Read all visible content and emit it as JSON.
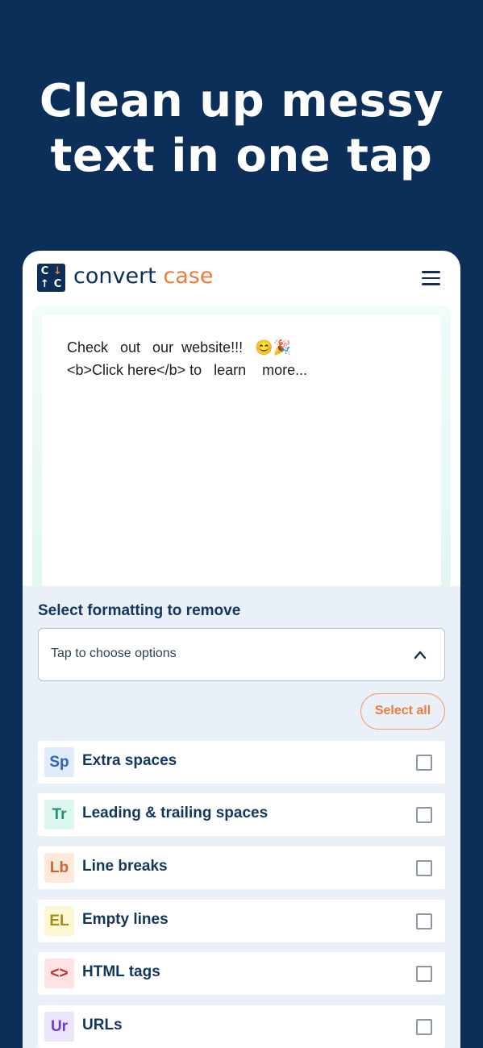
{
  "headline": {
    "line1": "Clean up messy",
    "line2": "text in one tap"
  },
  "app": {
    "brand_part1": "convert",
    "brand_part2": "case",
    "logo_glyphs": [
      "C",
      "↓",
      "↑",
      "C"
    ],
    "menu_icon": "hamburger-menu-icon"
  },
  "editor": {
    "text": "Check   out   our  website!!!   😊🎉\n<b>Click here</b> to   learn    more..."
  },
  "panel": {
    "title": "Select formatting to remove",
    "dropdown_label": "Tap to choose options",
    "dropdown_icon": "chevron-up-icon",
    "select_all_label": "Select all"
  },
  "options": [
    {
      "badge": "Sp",
      "label": "Extra spaces",
      "checked": false,
      "badge_bg": "#e1ecfb",
      "badge_fg": "#2f63b8"
    },
    {
      "badge": "Tr",
      "label": "Leading & trailing spaces",
      "checked": false,
      "badge_bg": "#dcf6ef",
      "badge_fg": "#1f8f72"
    },
    {
      "badge": "Lb",
      "label": "Line breaks",
      "checked": false,
      "badge_bg": "#fde8dc",
      "badge_fg": "#d0632a"
    },
    {
      "badge": "EL",
      "label": "Empty lines",
      "checked": false,
      "badge_bg": "#fdf7d4",
      "badge_fg": "#a88912"
    },
    {
      "badge": "<>",
      "label": "HTML tags",
      "checked": false,
      "badge_bg": "#fde3e3",
      "badge_fg": "#c72b2b"
    },
    {
      "badge": "Ur",
      "label": "URLs",
      "checked": false,
      "badge_bg": "#ece5fa",
      "badge_fg": "#6e3fc4"
    }
  ],
  "colors": {
    "background": "#0c2f5a",
    "accent": "#f07a3a",
    "text_primary": "#13365f"
  }
}
